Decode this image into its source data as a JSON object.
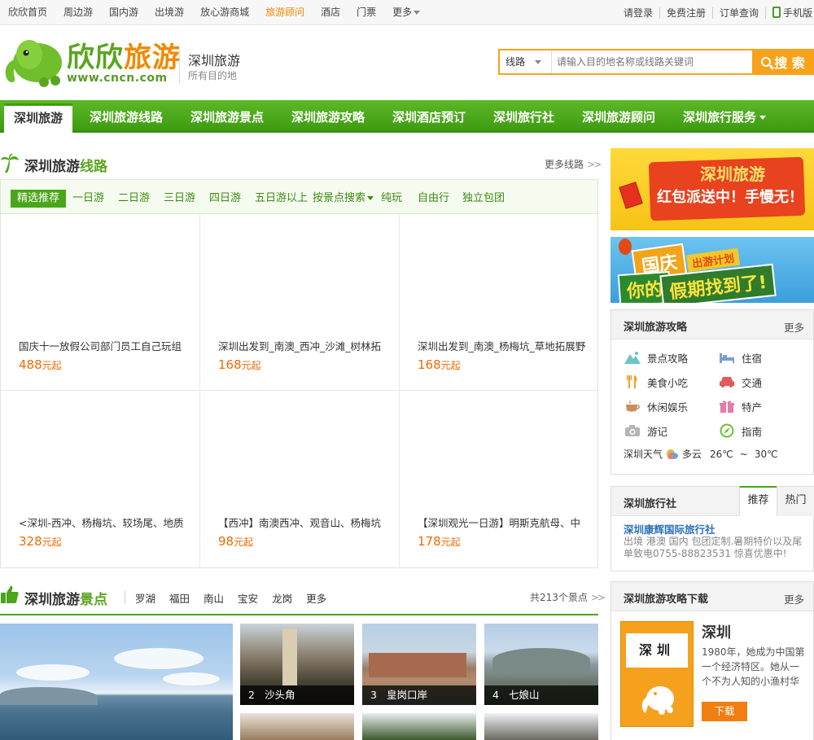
{
  "topbar": {
    "left_items": [
      {
        "label": "欣欣首页"
      },
      {
        "label": "周边游"
      },
      {
        "label": "国内游"
      },
      {
        "label": "出境游"
      },
      {
        "label": "放心游商城"
      },
      {
        "label": "旅游顾问",
        "highlight": true
      },
      {
        "label": "酒店"
      },
      {
        "label": "门票"
      },
      {
        "label": "更多"
      }
    ],
    "right_items": {
      "login": "请登录",
      "register": "免费注册",
      "orders": "订单查询",
      "mobile": "手机版"
    }
  },
  "header": {
    "logo_text_a": "欣欣",
    "logo_text_b": "旅游",
    "logo_url": "www.cncn.com",
    "city_name": "深圳旅游",
    "city_sub": "所有目的地",
    "search_type": "线路",
    "search_placeholder": "请输入目的地名称或线路关键词",
    "search_button": "搜 索"
  },
  "main_nav": [
    {
      "label": "深圳旅游",
      "active": true
    },
    {
      "label": "深圳旅游线路"
    },
    {
      "label": "深圳旅游景点"
    },
    {
      "label": "深圳旅游攻略"
    },
    {
      "label": "深圳酒店预订"
    },
    {
      "label": "深圳旅行社"
    },
    {
      "label": "深圳旅游顾问"
    },
    {
      "label": "深圳旅行服务",
      "dropdown": true
    }
  ],
  "routes": {
    "title_a": "深圳旅游",
    "title_b": "线路",
    "more": "更多线路",
    "tabs": [
      {
        "label": "精选推荐",
        "active": true
      },
      {
        "label": "一日游"
      },
      {
        "label": "二日游"
      },
      {
        "label": "三日游"
      },
      {
        "label": "四日游"
      },
      {
        "label": "五日游以上"
      },
      {
        "label": "按景点搜索",
        "dropdown": true
      },
      {
        "label": "纯玩"
      },
      {
        "label": "自由行"
      },
      {
        "label": "独立包团"
      }
    ],
    "items": [
      {
        "title": "国庆十一放假公司部门员工自己玩组",
        "price": "488",
        "unit": "元起"
      },
      {
        "title": "深圳出发到_南澳_西冲_沙滩_树林拓",
        "price": "168",
        "unit": "元起"
      },
      {
        "title": "深圳出发到_南澳_杨梅坑_草地拓展野",
        "price": "168",
        "unit": "元起"
      },
      {
        "title": "<深圳-西冲、杨梅坑、较场尾、地质",
        "price": "328",
        "unit": "元起"
      },
      {
        "title": "【西冲】南澳西冲、观音山、杨梅坑",
        "price": "98",
        "unit": "元起"
      },
      {
        "title": "【深圳观光一日游】明斯克航母、中",
        "price": "178",
        "unit": "元起"
      }
    ]
  },
  "scenic": {
    "title_a": "深圳旅游",
    "title_b": "景点",
    "districts": [
      "罗湖",
      "福田",
      "南山",
      "宝安",
      "龙岗",
      "更多"
    ],
    "count": "共213个景点",
    "photos": [
      {
        "num": "2",
        "name": "沙头角"
      },
      {
        "num": "3",
        "name": "皇岗口岸"
      },
      {
        "num": "4",
        "name": "七娘山"
      }
    ]
  },
  "banners": {
    "b1_line1": "深圳旅游",
    "b1_line2": "红包派送中！手慢无！",
    "b2_a": "国庆",
    "b2_b": "出游计划",
    "b2_c": "你的",
    "b2_d": "假期找到了!"
  },
  "guide": {
    "title": "深圳旅游攻略",
    "more": "更多",
    "items": [
      {
        "label": "景点攻略",
        "icon": "mountain-icon"
      },
      {
        "label": "住宿",
        "icon": "bed-icon"
      },
      {
        "label": "美食小吃",
        "icon": "fork-icon"
      },
      {
        "label": "交通",
        "icon": "car-icon"
      },
      {
        "label": "休闲娱乐",
        "icon": "cup-icon"
      },
      {
        "label": "特产",
        "icon": "gift-icon"
      },
      {
        "label": "游记",
        "icon": "camera-icon"
      },
      {
        "label": "指南",
        "icon": "compass-icon"
      }
    ],
    "weather_label": "深圳天气",
    "weather_state": "多云",
    "temp_low": "26℃",
    "dash": "~",
    "temp_high": "30℃"
  },
  "agency": {
    "title": "深圳旅行社",
    "tab_recommend": "推荐",
    "tab_hot": "热门",
    "name": "深圳康辉国际旅行社",
    "desc": "出境 港澳 国内 包团定制.暑期特价以及尾单致电0755-88823531 惊喜优惠中!"
  },
  "download": {
    "title": "深圳旅游攻略下载",
    "more": "更多",
    "book_title": "深圳",
    "book_name": "深圳",
    "desc": "1980年，她成为中国第一个经济特区。她从一个不为人知的小渔村华",
    "button": "下载"
  },
  "colors": {
    "brand_green": "#4aa51a",
    "brand_orange": "#f7a21b",
    "price_orange": "#f06a00",
    "link_blue": "#2a6fba"
  }
}
